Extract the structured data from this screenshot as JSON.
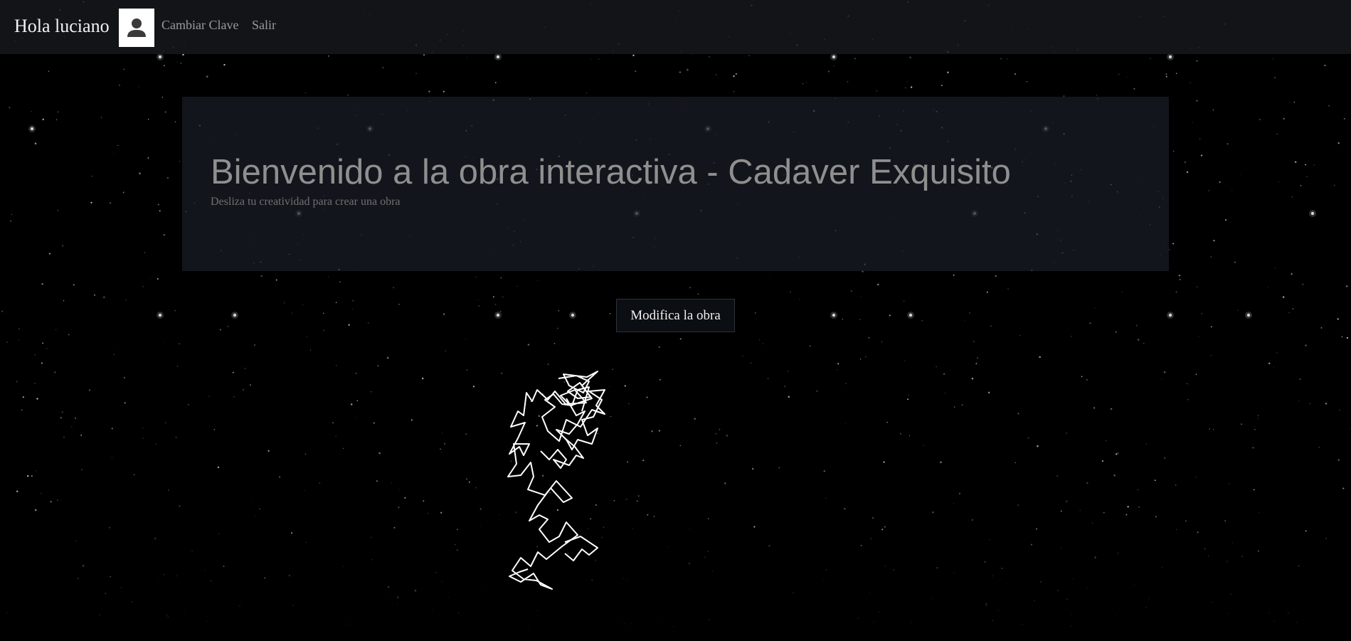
{
  "navbar": {
    "greeting": "Hola luciano",
    "avatar_icon": "user-icon",
    "links": {
      "change_password": "Cambiar Clave",
      "logout": "Salir"
    }
  },
  "jumbotron": {
    "title": "Bienvenido a la obra interactiva - Cadaver Exquisito",
    "subtitle": "Desliza tu creatividad para crear una obra"
  },
  "actions": {
    "modify_artwork": "Modifica la obra"
  },
  "colors": {
    "background": "#000000",
    "navbar": "#16181d",
    "panel": "#191d25",
    "title_text": "#8f8f8f",
    "stroke": "#ffffff"
  }
}
